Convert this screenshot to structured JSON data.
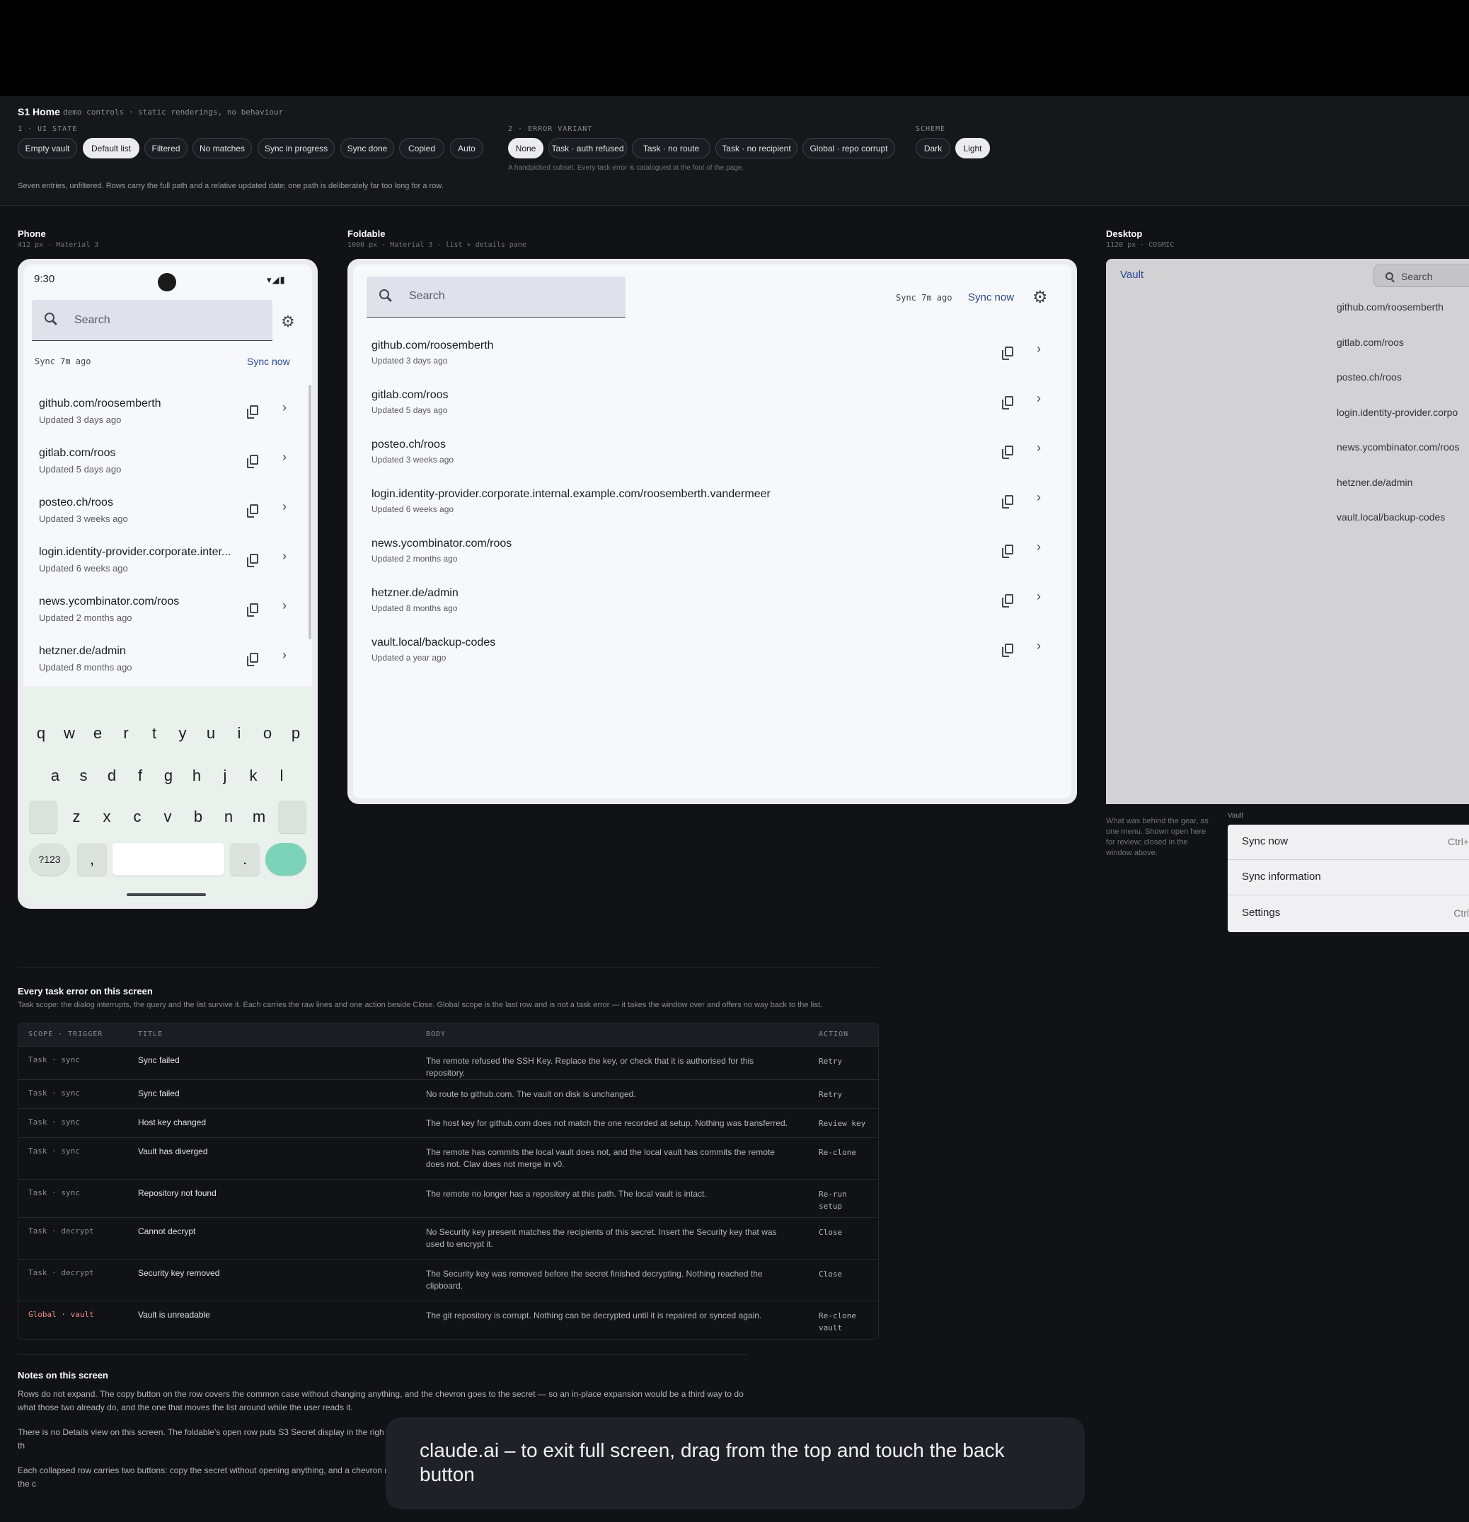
{
  "controls": {
    "title": "S1 Home",
    "subtitle": "demo controls · static renderings, no behaviour",
    "ui_state_label": "1 · UI STATE",
    "ui_states": [
      "Empty vault",
      "Default list",
      "Filtered",
      "No matches",
      "Sync in progress",
      "Sync done",
      "Copied",
      "Auto"
    ],
    "ui_state_selected": "Default list",
    "error_label": "2 · ERROR VARIANT",
    "errors": [
      "None",
      "Task · auth refused",
      "Task · no route",
      "Task · no recipient",
      "Global · repo corrupt"
    ],
    "error_selected": "None",
    "error_hint": "A handpicked subset. Every task error is catalogued at the foot of the page.",
    "scheme_label": "SCHEME",
    "schemes": [
      "Dark",
      "Light"
    ],
    "scheme_selected": "Light",
    "description": "Seven entries, unfiltered. Rows carry the full path and a relative updated date; one path is deliberately far too long for a row."
  },
  "phone": {
    "label": "Phone",
    "meta": "412 px · Material 3",
    "time": "9:30",
    "search_placeholder": "Search",
    "sync_status": "Sync 7m ago",
    "sync_now": "Sync now",
    "rows": [
      {
        "title": "github.com/roosemberth",
        "sub": "Updated 3 days ago"
      },
      {
        "title": "gitlab.com/roos",
        "sub": "Updated 5 days ago"
      },
      {
        "title": "posteo.ch/roos",
        "sub": "Updated 3 weeks ago"
      },
      {
        "title": "login.identity-provider.corporate.inter...",
        "sub": "Updated 6 weeks ago"
      },
      {
        "title": "news.ycombinator.com/roos",
        "sub": "Updated 2 months ago"
      },
      {
        "title": "hetzner.de/admin",
        "sub": "Updated 8 months ago"
      }
    ],
    "keyboard": {
      "row1": [
        "q",
        "w",
        "e",
        "r",
        "t",
        "y",
        "u",
        "i",
        "o",
        "p"
      ],
      "row2": [
        "a",
        "s",
        "d",
        "f",
        "g",
        "h",
        "j",
        "k",
        "l"
      ],
      "row3": [
        "z",
        "x",
        "c",
        "v",
        "b",
        "n",
        "m"
      ],
      "sym": "?123",
      "comma": ",",
      "period": "."
    }
  },
  "foldable": {
    "label": "Foldable",
    "meta": "1000 px · Material 3 · list + details pane",
    "search_placeholder": "Search",
    "sync_status": "Sync 7m ago",
    "sync_now": "Sync now",
    "rows": [
      {
        "title": "github.com/roosemberth",
        "sub": "Updated 3 days ago"
      },
      {
        "title": "gitlab.com/roos",
        "sub": "Updated 5 days ago"
      },
      {
        "title": "posteo.ch/roos",
        "sub": "Updated 3 weeks ago"
      },
      {
        "title": "login.identity-provider.corporate.internal.example.com/roosemberth.vandermeer",
        "sub": "Updated 6 weeks ago"
      },
      {
        "title": "news.ycombinator.com/roos",
        "sub": "Updated 2 months ago"
      },
      {
        "title": "hetzner.de/admin",
        "sub": "Updated 8 months ago"
      },
      {
        "title": "vault.local/backup-codes",
        "sub": "Updated a year ago"
      }
    ]
  },
  "desktop": {
    "label": "Desktop",
    "meta": "1120 px · COSMIC",
    "app_title": "Vault",
    "search_placeholder": "Search",
    "rows": [
      "github.com/roosemberth",
      "gitlab.com/roos",
      "posteo.ch/roos",
      "login.identity-provider.corpo",
      "news.ycombinator.com/roos",
      "hetzner.de/admin",
      "vault.local/backup-codes"
    ],
    "menu_caption": "What was behind the gear, as one menu. Shown open here for review; closed in the window above.",
    "menu_label": "Vault",
    "menu_items": [
      {
        "label": "Sync now",
        "shortcut": "Ctrl+"
      },
      {
        "label": "Sync information",
        "shortcut": ""
      },
      {
        "label": "Settings",
        "shortcut": "Ctrl"
      }
    ]
  },
  "errors_section": {
    "title": "Every task error on this screen",
    "subtitle": "Task scope: the dialog interrupts, the query and the list survive it. Each carries the raw lines and one action beside Close. Global scope is the last row and is not a task error — it takes the window over and offers no way back to the list.",
    "headers": [
      "SCOPE · TRIGGER",
      "TITLE",
      "BODY",
      "ACTION"
    ],
    "rows": [
      {
        "scope": "Task · sync",
        "title": "Sync failed",
        "body": "The remote refused the SSH Key. Replace the key, or check that it is authorised for this repository.",
        "action": "Retry"
      },
      {
        "scope": "Task · sync",
        "title": "Sync failed",
        "body": "No route to github.com. The vault on disk is unchanged.",
        "action": "Retry"
      },
      {
        "scope": "Task · sync",
        "title": "Host key changed",
        "body": "The host key for github.com does not match the one recorded at setup. Nothing was transferred.",
        "action": "Review key"
      },
      {
        "scope": "Task · sync",
        "title": "Vault has diverged",
        "body": "The remote has commits the local vault does not, and the local vault has commits the remote does not. Clav does not merge in v0.",
        "action": "Re-clone"
      },
      {
        "scope": "Task · sync",
        "title": "Repository not found",
        "body": "The remote no longer has a repository at this path. The local vault is intact.",
        "action": "Re-run setup"
      },
      {
        "scope": "Task · decrypt",
        "title": "Cannot decrypt",
        "body": "No Security key present matches the recipients of this secret. Insert the Security key that was used to encrypt it.",
        "action": "Close"
      },
      {
        "scope": "Task · decrypt",
        "title": "Security key removed",
        "body": "The Security key was removed before the secret finished decrypting. Nothing reached the clipboard.",
        "action": "Close"
      },
      {
        "scope": "Global · vault",
        "title": "Vault is unreadable",
        "body": "The git repository is corrupt. Nothing can be decrypted until it is repaired or synced again.",
        "action": "Re-clone vault"
      }
    ]
  },
  "notes": {
    "title": "Notes on this screen",
    "p1": "Rows do not expand. The copy button on the row covers the common case without changing anything, and the chevron goes to the secret — so an in-place expansion would be a third way to do what those two already do, and the one that moves the list around while the user reads it.",
    "p2": "There is no Details view on this screen. The foldable's open row puts S3 Secret display in the righ and desktop reach S3 as its own view. A separate Details screen would have been a third place th",
    "p3": "Each collapsed row carries two buttons: copy the secret without opening anything, and a chevron row's own affordance visible, which is how COSMIC Settings draws its navigation rows — and the c"
  },
  "toast": "claude.ai – to exit full screen, drag from the top and touch the back button"
}
